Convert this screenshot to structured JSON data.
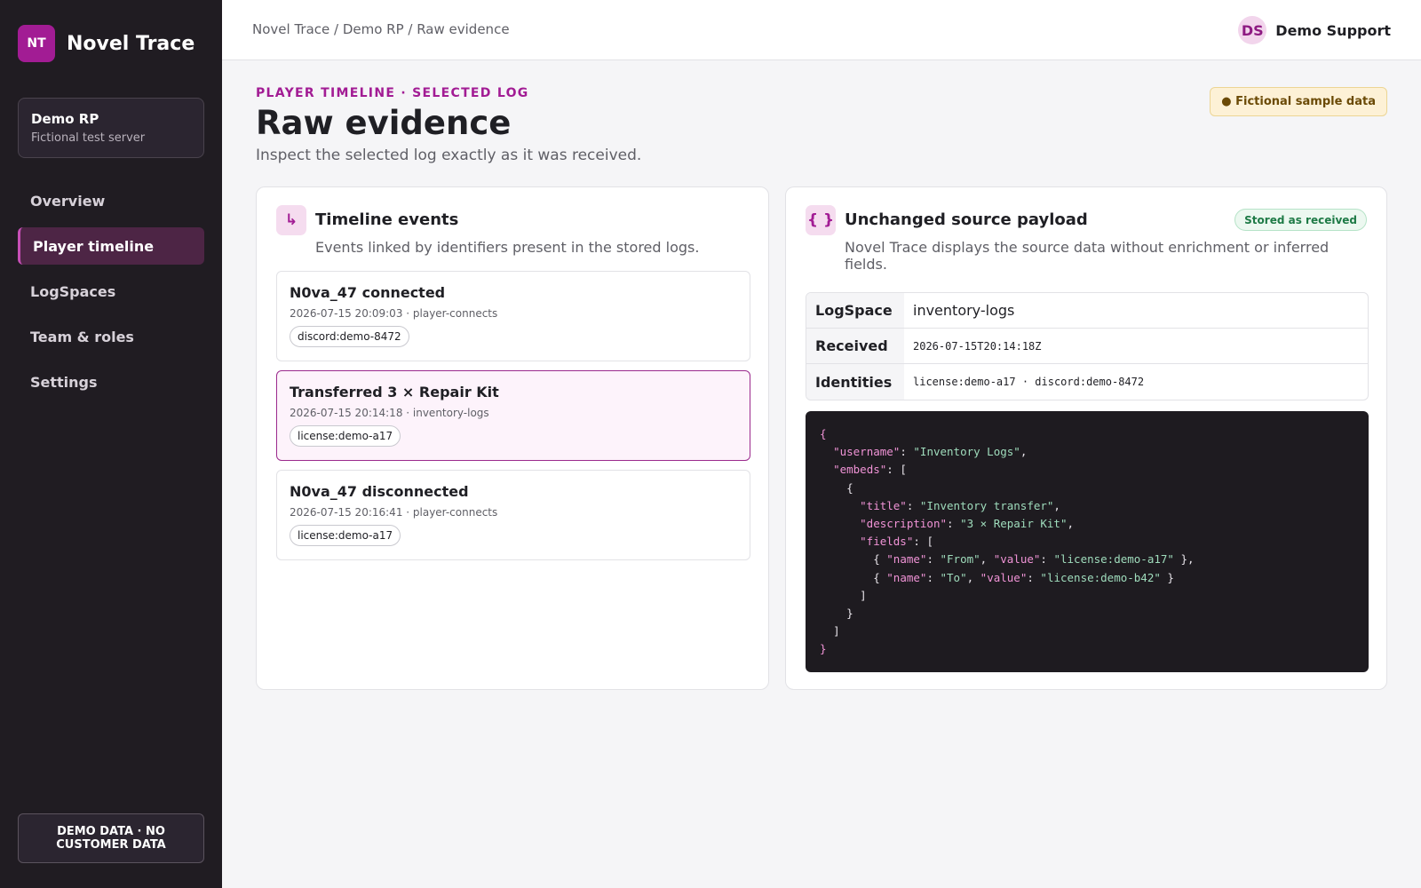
{
  "brand": {
    "logo_initials": "NT",
    "name": "Novel Trace",
    "accent": "#a21c94"
  },
  "server": {
    "name": "Demo RP",
    "subtitle": "Fictional test server"
  },
  "nav": [
    {
      "label": "Overview"
    },
    {
      "label": "Player timeline",
      "active": true
    },
    {
      "label": "LogSpaces"
    },
    {
      "label": "Team & roles"
    },
    {
      "label": "Settings"
    }
  ],
  "sidebar_footer": "DEMO DATA · NO CUSTOMER DATA",
  "topbar": {
    "breadcrumb": "Novel Trace / Demo RP / Raw evidence",
    "user_initials": "DS",
    "user_name": "Demo Support"
  },
  "header": {
    "eyebrow": "PLAYER TIMELINE · SELECTED LOG",
    "title": "Raw evidence",
    "subtitle": "Inspect the selected log exactly as it was received.",
    "badge": "● Fictional sample data"
  },
  "timeline": {
    "icon": "↳",
    "title": "Timeline events",
    "description": "Events linked by identifiers present in the stored logs.",
    "events": [
      {
        "title": "N0va_47 connected",
        "meta": "2026-07-15 20:09:03 · player-connects",
        "tag": "discord:demo-8472",
        "selected": false
      },
      {
        "title": "Transferred 3 × Repair Kit",
        "meta": "2026-07-15 20:14:18 · inventory-logs",
        "tag": "license:demo-a17",
        "selected": true
      },
      {
        "title": "N0va_47 disconnected",
        "meta": "2026-07-15 20:16:41 · player-connects",
        "tag": "license:demo-a17",
        "selected": false
      }
    ]
  },
  "payload": {
    "icon": "{ }",
    "title": "Unchanged source payload",
    "badge": "Stored as received",
    "description": "Novel Trace displays the source data without enrichment or inferred fields.",
    "meta": [
      {
        "key": "LogSpace",
        "value": "inventory-logs",
        "mono": false
      },
      {
        "key": "Received",
        "value": "2026-07-15T20:14:18Z",
        "mono": true
      },
      {
        "key": "Identities",
        "value": "license:demo-a17 · discord:demo-8472",
        "mono": true
      }
    ],
    "code_lines": [
      "{",
      "  \"username\": \"Inventory Logs\",",
      "  \"embeds\": [",
      "    {",
      "      \"title\": \"Inventory transfer\",",
      "      \"description\": \"3 × Repair Kit\",",
      "      \"fields\": [",
      "        { \"name\": \"From\", \"value\": \"license:demo-a17\" },",
      "        { \"name\": \"To\", \"value\": \"license:demo-b42\" }",
      "      ]",
      "    }",
      "  ]",
      "}"
    ]
  }
}
